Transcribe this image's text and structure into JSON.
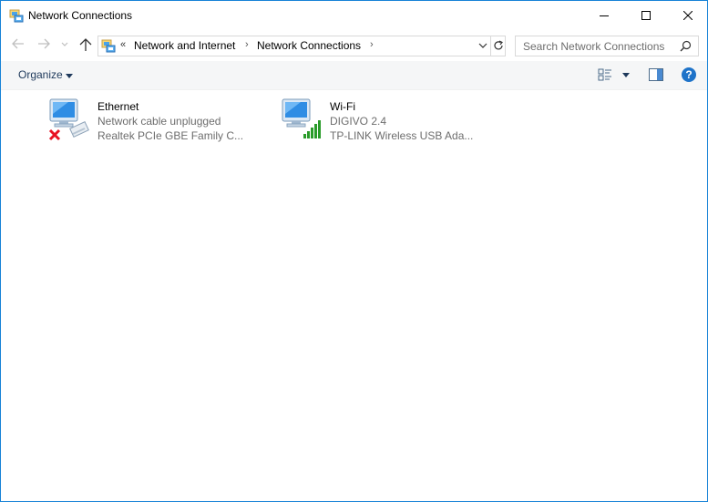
{
  "window": {
    "title": "Network Connections",
    "title_icon": "network-folder-icon",
    "controls": {
      "minimize": "minimize-icon",
      "maximize": "maximize-icon",
      "close": "close-icon"
    }
  },
  "navigation": {
    "back_icon": "back-arrow-icon",
    "forward_icon": "forward-arrow-icon",
    "recent_icon": "chevron-down-icon",
    "up_icon": "up-arrow-icon",
    "address": {
      "overflow": "«",
      "crumbs": [
        "Network and Internet",
        "Network Connections"
      ],
      "separator": "›"
    },
    "search": {
      "placeholder": "Search Network Connections"
    }
  },
  "command_bar": {
    "organize_label": "Organize",
    "view_icon": "change-view-icon",
    "preview_pane_icon": "preview-pane-icon",
    "help_label": "?"
  },
  "connections": [
    {
      "name": "Ethernet",
      "status": "Network cable unplugged",
      "device": "Realtek PCIe GBE Family C...",
      "icon": "ethernet-disconnected-icon",
      "status_color": "#e81123"
    },
    {
      "name": "Wi-Fi",
      "status": "DIGIVO 2.4",
      "device": "TP-LINK Wireless USB Ada...",
      "icon": "wifi-signal-icon",
      "status_color": "#2a9b2a"
    }
  ],
  "colors": {
    "accent": "#1883d7",
    "command_text": "#1e395b",
    "secondary_text": "#6d6d6d"
  }
}
